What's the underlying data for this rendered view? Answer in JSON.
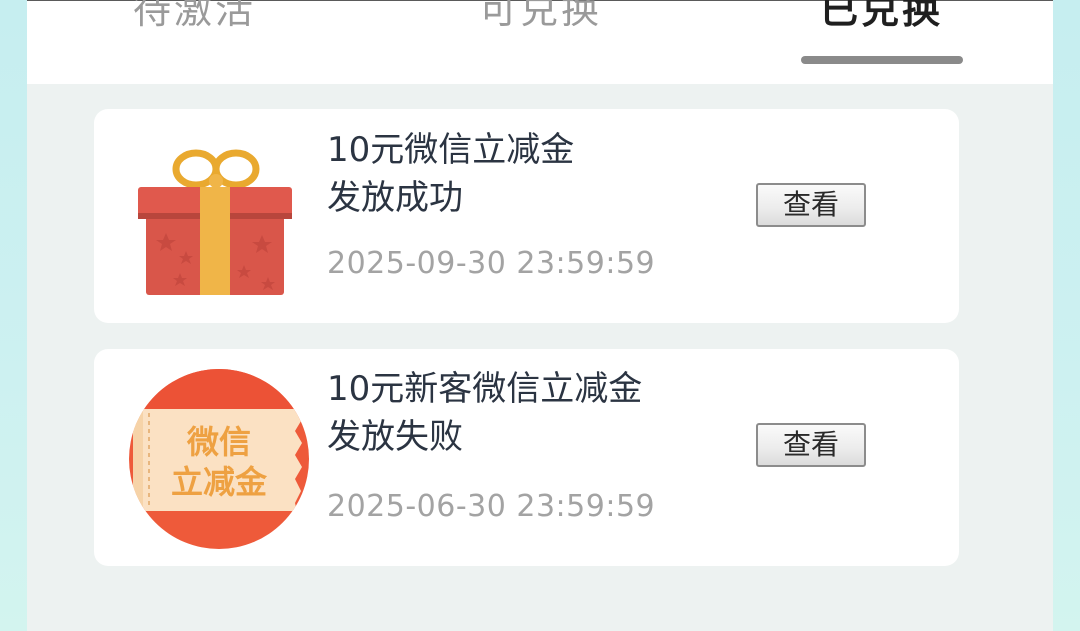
{
  "tabs": [
    {
      "label": "待激活",
      "active": false
    },
    {
      "label": "可兑换",
      "active": false
    },
    {
      "label": "已兑换",
      "active": true
    }
  ],
  "items": [
    {
      "title_line1": "10元微信立减金",
      "title_line2": "发放成功",
      "date": "2025-09-30 23:59:59",
      "button": "查看",
      "icon": "gift-box-icon"
    },
    {
      "title_line1": "10元新客微信立减金",
      "title_line2": "发放失败",
      "date": "2025-06-30 23:59:59",
      "button": "查看",
      "icon": "wechat-coupon-icon",
      "icon_text_line1": "微信",
      "icon_text_line2": "立减金"
    }
  ],
  "colors": {
    "accent_gift_red": "#dc5a4e",
    "ribbon_gold": "#f0b548",
    "coupon_red": "#ee5a3a"
  }
}
